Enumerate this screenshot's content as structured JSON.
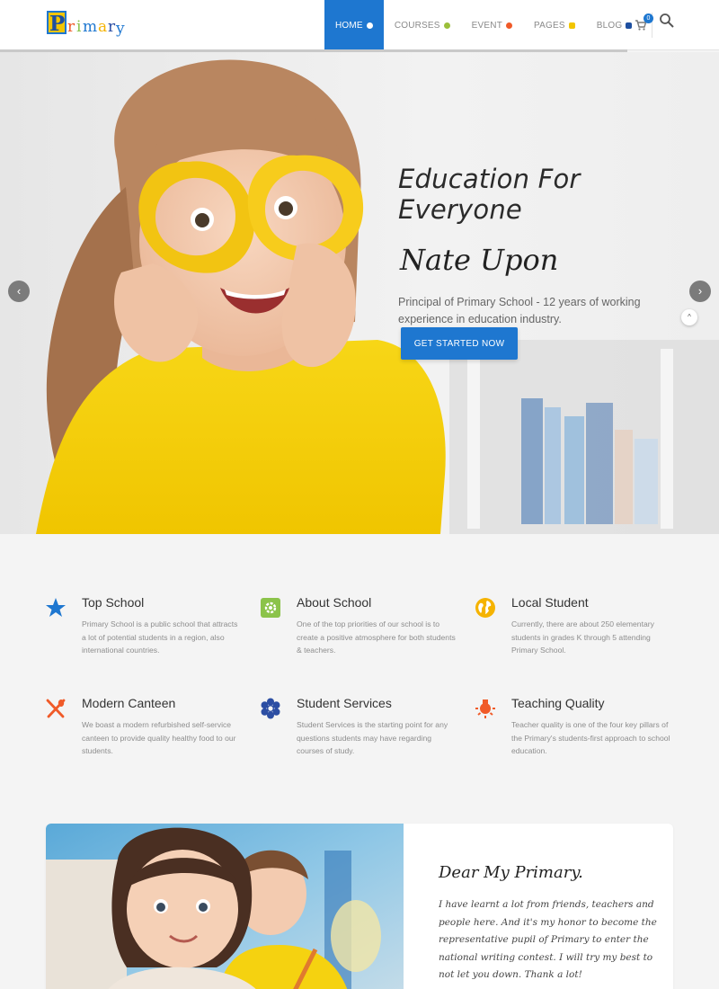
{
  "header": {
    "logo_text": "Primary",
    "nav": [
      {
        "label": "HOME",
        "icon": "home-icon",
        "icon_color": "#ffffff"
      },
      {
        "label": "COURSES",
        "icon": "palette-icon",
        "icon_color": "#9bbf3a"
      },
      {
        "label": "EVENT",
        "icon": "sun-icon",
        "icon_color": "#f05a28"
      },
      {
        "label": "PAGES",
        "icon": "note-icon",
        "icon_color": "#f2c500"
      },
      {
        "label": "BLOG",
        "icon": "folder-icon",
        "icon_color": "#1e4fa0"
      }
    ],
    "cart_count": "0"
  },
  "hero": {
    "title": "Education For Everyone",
    "signature": "Nate Upon",
    "subtitle": "Principal of Primary School - 12 years of working experience in education industry.",
    "cta": "GET STARTED NOW",
    "prev": "‹",
    "next": "›",
    "scroll_top": "^"
  },
  "features": [
    {
      "title": "Top School",
      "icon": "star-icon",
      "text": "Primary School is a public school that attracts a lot of potential students in a region, also international countries."
    },
    {
      "title": "About School",
      "icon": "gear-icon",
      "text": "One of the top priorities of our school is to create a positive atmosphere for both students & teachers."
    },
    {
      "title": "Local Student",
      "icon": "globe-icon",
      "text": "Currently, there are about 250 elementary students in grades K through 5 attending Primary School."
    },
    {
      "title": "Modern Canteen",
      "icon": "utensils-icon",
      "text": "We boast a modern refurbished self-service canteen to provide quality healthy food to our students."
    },
    {
      "title": "Student Services",
      "icon": "flower-icon",
      "text": "Student Services is the starting point for any questions students may have regarding courses of study."
    },
    {
      "title": "Teaching Quality",
      "icon": "lamp-icon",
      "text": "Teacher quality is one of the four key pillars of the Primary's students-first approach to school education."
    }
  ],
  "testimonial": {
    "title": "Dear My Primary.",
    "body": "I have learnt a lot from friends, teachers and people here. And it's my honor to become the representative pupil of Primary to enter the national writing contest. I will try my best to not let you down. Thank a lot!"
  },
  "colors": {
    "accent": "#1e77d0",
    "star": "#1e77d0",
    "gear": "#8bc34a",
    "globe": "#f5b301",
    "utensils": "#f05a28",
    "flower": "#2c4ea3",
    "lamp": "#f05a28"
  }
}
